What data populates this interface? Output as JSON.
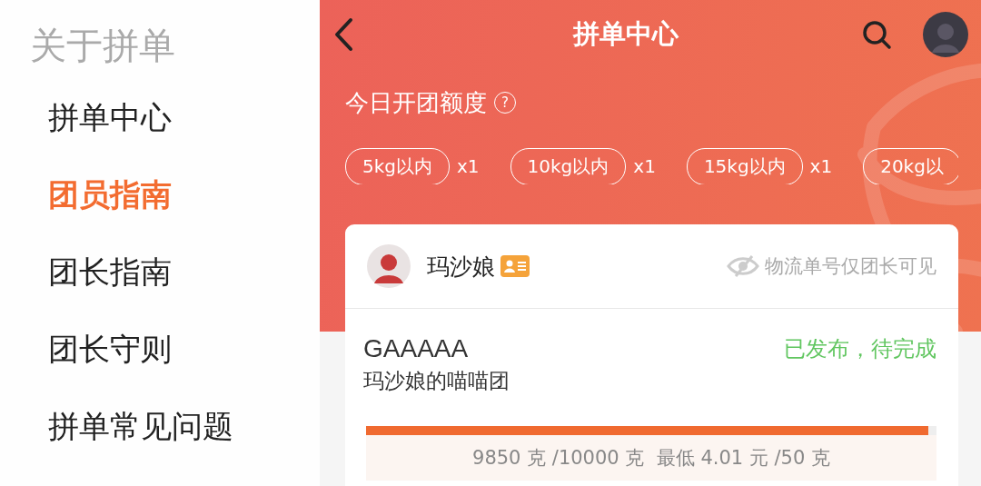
{
  "sidebar": {
    "title": "关于拼单",
    "items": [
      {
        "label": "拼单中心",
        "selected": false
      },
      {
        "label": "团员指南",
        "selected": true
      },
      {
        "label": "团长指南",
        "selected": false
      },
      {
        "label": "团长守则",
        "selected": false
      },
      {
        "label": "拼单常见问题",
        "selected": false
      }
    ]
  },
  "header": {
    "title": "拼单中心",
    "quota_title": "今日开团额度",
    "help": "?",
    "quotas": [
      {
        "label": "5kg以内",
        "count": "x1"
      },
      {
        "label": "10kg以内",
        "count": "x1"
      },
      {
        "label": "15kg以内",
        "count": "x1"
      },
      {
        "label": "20kg以"
      }
    ]
  },
  "card": {
    "user": "玛沙娘",
    "privacy_note": "物流单号仅团长可见",
    "code": "GAAAAA",
    "group_name": "玛沙娘的喵喵团",
    "status": "已发布，待完成",
    "progress": {
      "level": 0.985
    },
    "summary": "9850 克 /10000 克  最低 4.01 元 /50 克"
  }
}
